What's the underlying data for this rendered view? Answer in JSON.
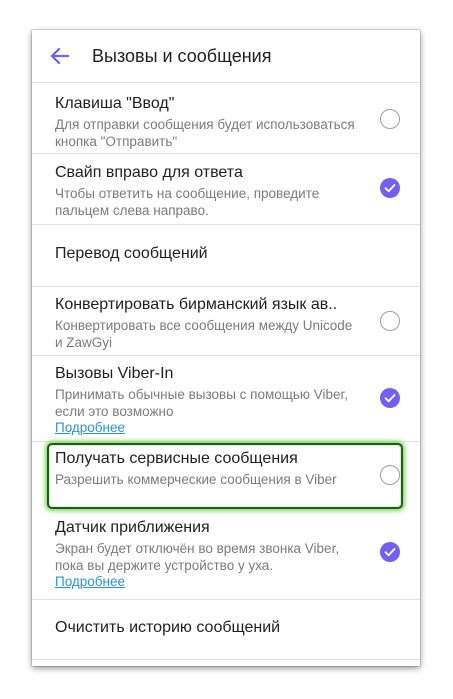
{
  "header": {
    "back_icon": "back-arrow-icon",
    "title": "Вызовы и сообщения"
  },
  "colors": {
    "accent": "#7360f2",
    "link": "#2f8fe0",
    "highlight": "#1c5b1c"
  },
  "settings": [
    {
      "title": "Клавиша \"Ввод\"",
      "subtitle": "Для отправки сообщения будет использоваться кнопка \"Отправить\"",
      "checked": false
    },
    {
      "title": "Свайп вправо для ответа",
      "subtitle": "Чтобы ответить на сообщение, проведите пальцем слева направо.",
      "checked": true
    },
    {
      "title": "Перевод сообщений"
    },
    {
      "title": "Конвертировать бирманский язык ав..",
      "subtitle": "Конвертировать все сообщения между Unicode и ZawGyi",
      "checked": false
    },
    {
      "title": "Вызовы Viber-In",
      "subtitle": "Принимать обычные вызовы с помощью Viber, если это возможно",
      "link": "Подробнее",
      "checked": true
    },
    {
      "title": "Получать сервисные сообщения",
      "subtitle": "Разрешить коммерческие сообщения в Viber",
      "checked": false,
      "highlighted": true
    },
    {
      "title": "Датчик приближения",
      "subtitle": "Экран будет отключён во время звонка Viber, пока вы держите устройство у уха.",
      "link": "Подробнее",
      "checked": true
    },
    {
      "title": "Очистить историю сообщений"
    }
  ]
}
